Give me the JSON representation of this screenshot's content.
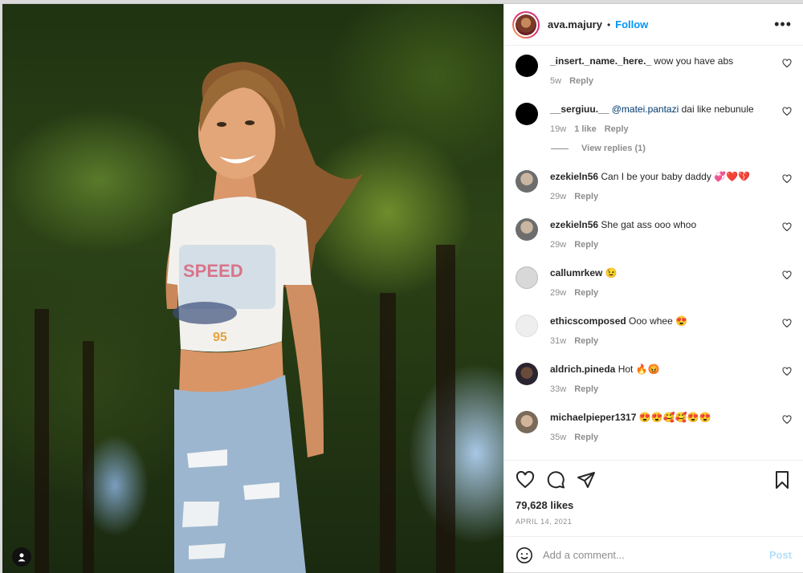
{
  "header": {
    "username": "ava.majury",
    "dot": "•",
    "follow_label": "Follow",
    "more_label": "•••"
  },
  "comments": [
    {
      "user": "_insert._name._here._",
      "text": "wow you have abs",
      "time": "5w",
      "likes": "",
      "reply": "Reply",
      "avatar_color": "#000000"
    },
    {
      "user": "__sergiuu.__",
      "mention": "@matei.pantazi",
      "text": "dai like nebunule",
      "time": "19w",
      "likes": "1 like",
      "reply": "Reply",
      "avatar_color": "#000000",
      "view_replies": "View replies (1)"
    },
    {
      "user": "ezekieln56",
      "text": "Can I be your baby daddy 💞❤️💔",
      "time": "29w",
      "likes": "",
      "reply": "Reply",
      "avatar_color": "#8a8a8a"
    },
    {
      "user": "ezekieln56",
      "text": "She gat ass ooo whoo",
      "time": "29w",
      "likes": "",
      "reply": "Reply",
      "avatar_color": "#8a8a8a"
    },
    {
      "user": "callumrkew",
      "text": "😉",
      "time": "29w",
      "likes": "",
      "reply": "Reply",
      "avatar_color": "#d8d8d8"
    },
    {
      "user": "ethicscomposed",
      "text": "Ooo whee 😍",
      "time": "31w",
      "likes": "",
      "reply": "Reply",
      "avatar_color": "#e6e6e6"
    },
    {
      "user": "aldrich.pineda",
      "text": "Hot 🔥😡",
      "time": "33w",
      "likes": "",
      "reply": "Reply",
      "avatar_color": "#3a2a2a"
    },
    {
      "user": "michaelpieper1317",
      "text": "😍😍🥰🥰😍😍",
      "time": "35w",
      "likes": "",
      "reply": "Reply",
      "avatar_color": "#b0a090"
    }
  ],
  "actions": {
    "likes": "79,628 likes",
    "date": "APRIL 14, 2021"
  },
  "add_comment": {
    "placeholder": "Add a comment...",
    "post_label": "Post"
  },
  "icons": {
    "like": "heart-icon",
    "comment": "comment-icon",
    "share": "share-icon",
    "save": "bookmark-icon",
    "emoji": "emoji-icon",
    "user_tag": "user-tag-icon"
  }
}
